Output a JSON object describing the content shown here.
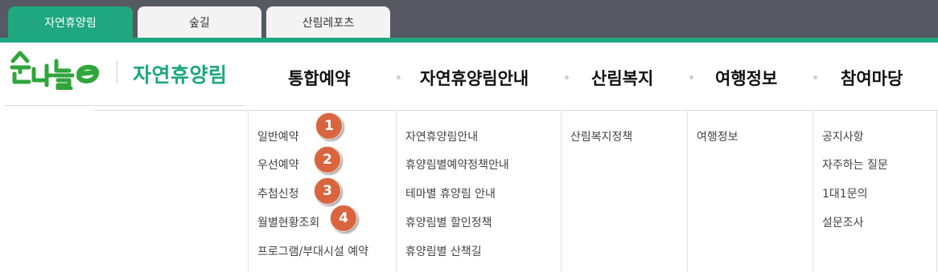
{
  "site_tabs": [
    {
      "label": "자연휴양림",
      "active": true
    },
    {
      "label": "숲길",
      "active": false
    },
    {
      "label": "산림레포츠",
      "active": false
    }
  ],
  "logo": {
    "wordmark": "숲나들e",
    "title": "자연휴양림"
  },
  "gnb": [
    {
      "label": "통합예약",
      "sub": [
        "일반예약",
        "우선예약",
        "추첨신청",
        "월별현황조회",
        "프로그램/부대시설 예약"
      ]
    },
    {
      "label": "자연휴양림안내",
      "sub": [
        "자연휴양림안내",
        "휴양림별예약정책안내",
        "테마별 휴양림 안내",
        "휴양림별 할인정책",
        "휴양림별 산책길"
      ]
    },
    {
      "label": "산림복지",
      "sub": [
        "산림복지정책"
      ]
    },
    {
      "label": "여행정보",
      "sub": [
        "여행정보"
      ]
    },
    {
      "label": "참여마당",
      "sub": [
        "공지사항",
        "자주하는 질문",
        "1대1문의",
        "설문조사"
      ]
    }
  ],
  "badges": [
    "1",
    "2",
    "3",
    "4"
  ],
  "colors": {
    "brand_green": "#1fa77f",
    "topbar": "#565962",
    "badge": "#d9653f"
  }
}
